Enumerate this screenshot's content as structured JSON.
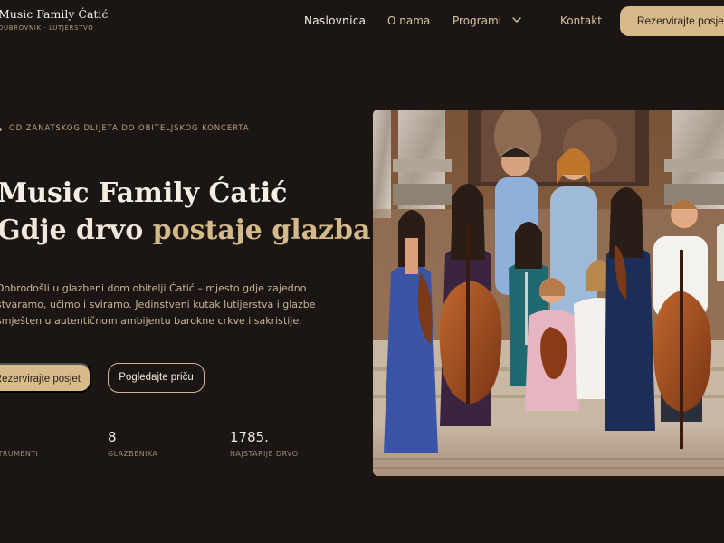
{
  "brand": {
    "title": "Music Family Ćatić",
    "subtitle": "DUBROVNIK · LUTJERSTVO"
  },
  "nav": {
    "items": [
      "Naslovnica",
      "O nama",
      "Programi",
      "Kontakt"
    ],
    "cta": "Rezervirajte posjet"
  },
  "hero": {
    "eyebrow": "OD ZANATSKOG DLIJETA DO OBITELJSKOG KONCERTA",
    "title_line1": "Music Family Ćatić",
    "title_line2_a": "Gdje drvo ",
    "title_line2_b": "postaje glazba",
    "description": "Dobrodošli u glazbeni dom obitelji Ćatić – mjesto gdje zajedno stvaramo, učimo i sviramo. Jedinstveni kutak lutijerstva i glazbe smješten u autentičnom ambijentu barokne crkve i sakristije.",
    "primary_button": "Rezervirajte posjet",
    "secondary_button": "Pogledajte priču"
  },
  "stats": [
    {
      "value": "",
      "label": "INSTRUMENTI"
    },
    {
      "value": "8",
      "label": "GLAZBENIKA"
    },
    {
      "value": "1785.",
      "label": "NAJSTARIJE DRVO"
    }
  ],
  "photo": {
    "subject": "family-ensemble-photo"
  },
  "colors": {
    "background": "#1b1514",
    "accent": "#d6ba8a",
    "text": "#efe6d8"
  }
}
